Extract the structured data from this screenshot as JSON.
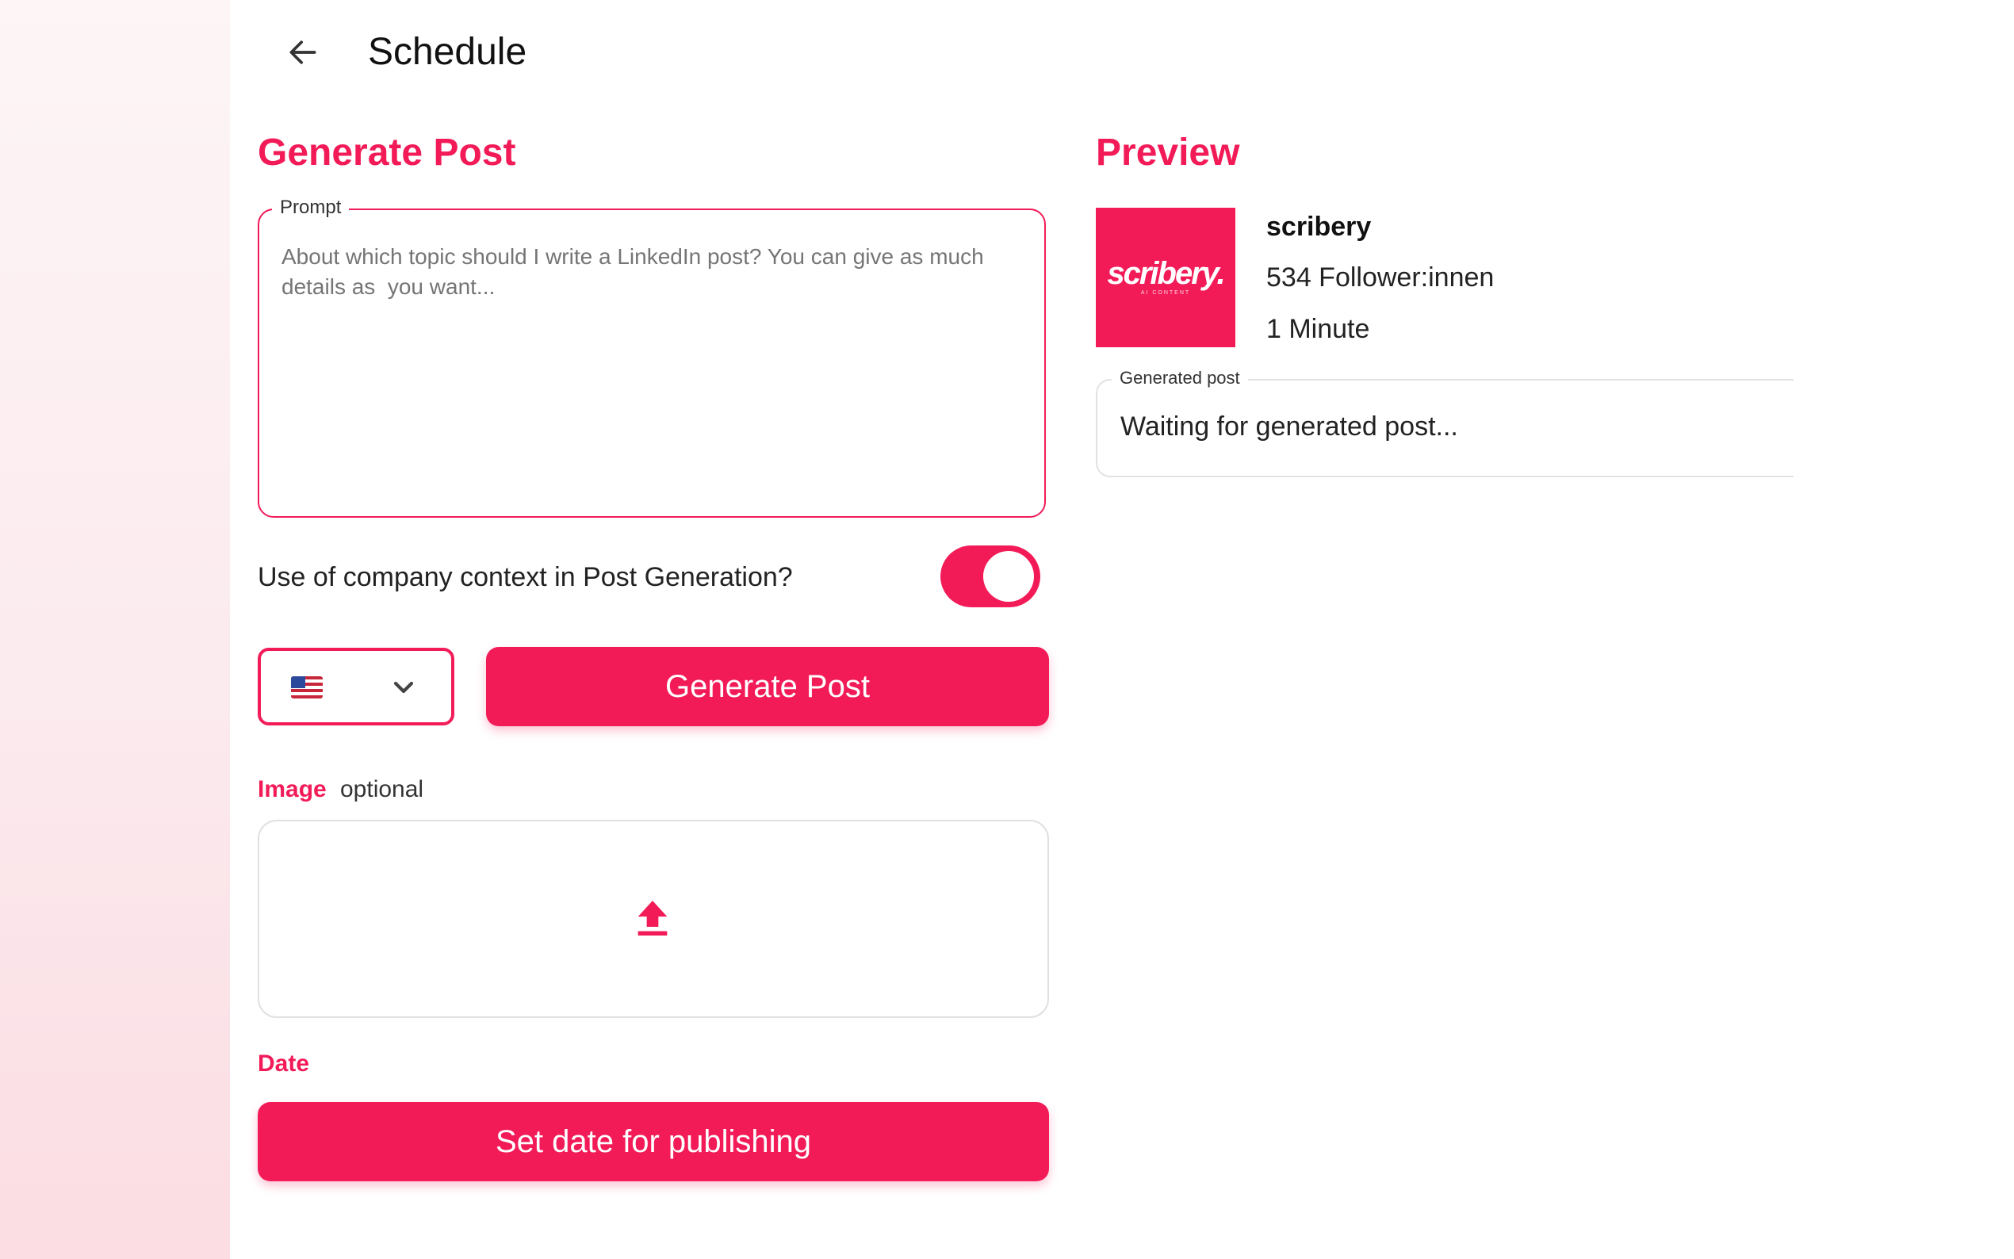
{
  "header": {
    "title": "Schedule",
    "back_icon": "arrow-left-icon"
  },
  "generate": {
    "section_title": "Generate Post",
    "prompt": {
      "label": "Prompt",
      "placeholder": "About which topic should I write a LinkedIn post? You can give as much details as  you want..."
    },
    "context_toggle": {
      "label": "Use of  company context in Post Generation?",
      "enabled": true
    },
    "language": {
      "selected": "US flag",
      "icon": "us-flag-icon"
    },
    "generate_button": "Generate Post",
    "image": {
      "label": "Image",
      "optional": "optional",
      "upload_icon": "upload-icon"
    },
    "date": {
      "label": "Date",
      "button": "Set date for publishing"
    }
  },
  "preview": {
    "section_title": "Preview",
    "logo_text": "scribery.",
    "logo_subtext": "AI CONTENT",
    "account_name": "scribery",
    "followers": "534 Follower:innen",
    "time": "1 Minute",
    "generated_post": {
      "label": "Generated post",
      "text": "Waiting for generated post..."
    }
  },
  "colors": {
    "accent": "#f21b58",
    "sidebar_gradient_end": "#fbdde3"
  }
}
